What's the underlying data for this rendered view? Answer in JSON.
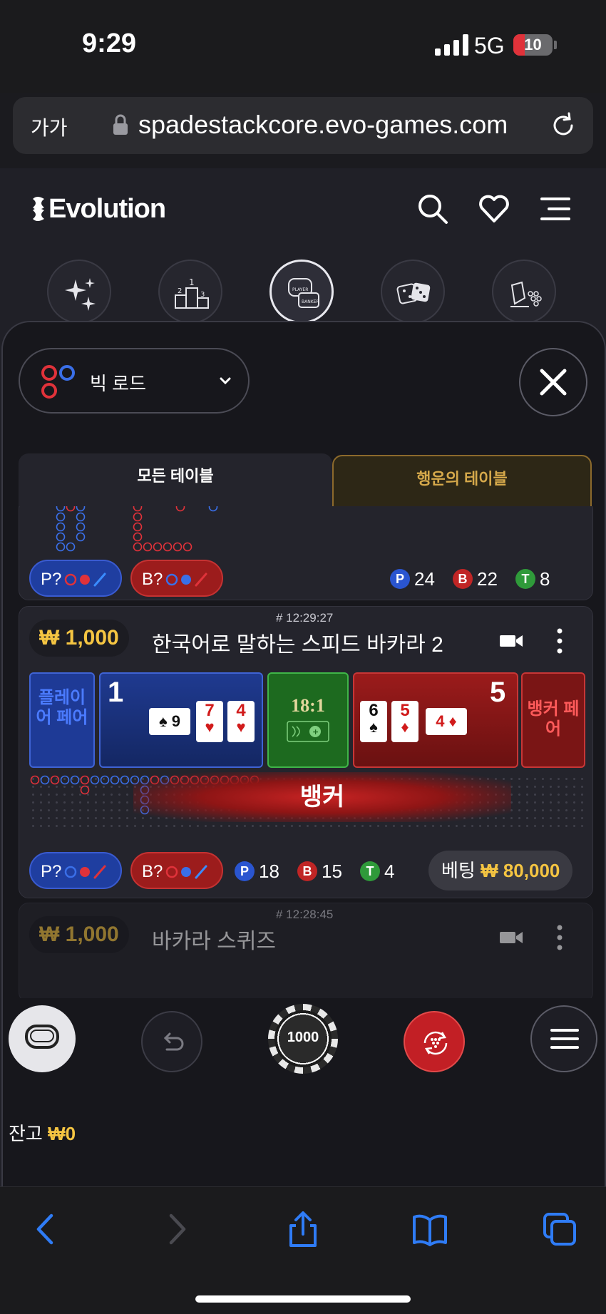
{
  "status": {
    "time": "9:29",
    "network": "5G",
    "battery": "10",
    "battery_level": 0.1
  },
  "browser": {
    "text_size": "가가",
    "url": "spadestackcore.evo-games.com"
  },
  "header": {
    "brand": "Evolution"
  },
  "categories": [
    "sparkle-icon",
    "podium-icon",
    "baccarat-icon",
    "dice-icon",
    "roulette-icon"
  ],
  "view_selector": {
    "label": "빅 로드"
  },
  "tabs": {
    "all": "모든 테이블",
    "lucky": "행운의 테이블"
  },
  "table_top": {
    "player_pill": "P?",
    "banker_pill": "B?",
    "stats": {
      "p_letter": "P",
      "p": "24",
      "b_letter": "B",
      "b": "22",
      "t_letter": "T",
      "t": "8"
    }
  },
  "table_main": {
    "stake": "₩ 1,000",
    "id": "# 12:29:27",
    "name": "한국어로 말하는 스피드 바카라 2",
    "player_pair": "플레이어 페어",
    "player_score": "1",
    "player_cards": [
      {
        "rank": "7",
        "suit": "♥"
      },
      {
        "rank": "4",
        "suit": "♥"
      }
    ],
    "player_side_card": "♠ 9",
    "tie": "18:1",
    "banker_score": "5",
    "banker_cards": [
      {
        "rank": "6",
        "suit": "♠"
      },
      {
        "rank": "5",
        "suit": "♦"
      }
    ],
    "banker_side_card": "4 ♦",
    "banker_pair": "뱅커 페어",
    "result": "뱅커",
    "player_pill": "P?",
    "banker_pill": "B?",
    "stats": {
      "p_letter": "P",
      "p": "18",
      "b_letter": "B",
      "b": "15",
      "t_letter": "T",
      "t": "4"
    },
    "bet_label": "베팅",
    "bet_value": "₩ 80,000"
  },
  "table_third": {
    "stake": "₩ 1,000",
    "id": "# 12:28:45",
    "name": "바카라 스퀴즈"
  },
  "controls": {
    "chip": "1000"
  },
  "balance": {
    "label": "잔고",
    "value": "₩0"
  },
  "colors": {
    "player": "#1f3ea0",
    "banker": "#9c1c1c",
    "tie": "#1d6a1f",
    "gold": "#f5c542",
    "safari_blue": "#2f7cf6"
  }
}
